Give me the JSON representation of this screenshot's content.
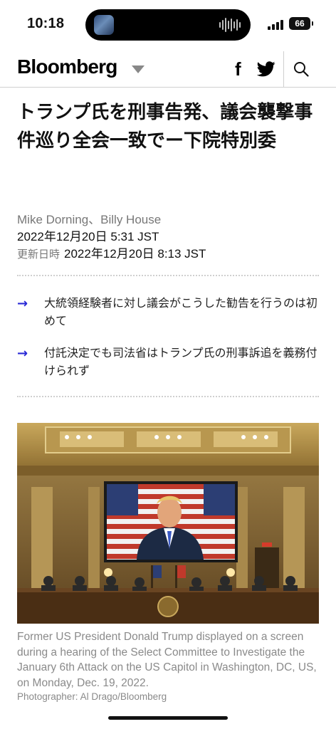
{
  "status_bar": {
    "time": "10:18",
    "battery": "66"
  },
  "nav": {
    "logo": "Bloomberg"
  },
  "article": {
    "headline": "トランプ氏を刑事告発、議会襲撃事件巡り全会一致でー下院特別委",
    "authors": "Mike Dorning、Billy House",
    "published": "2022年12月20日 5:31 JST",
    "updated_label": "更新日時",
    "updated": "2022年12月20日 8:13 JST",
    "bullets": [
      {
        "arrow": "→",
        "text": "大統領経験者に対し議会がこうした勧告を行うのは初めて"
      },
      {
        "arrow": "→",
        "text": "付託決定でも司法省はトランプ氏の刑事訴追を義務付けられず"
      }
    ],
    "caption": "Former US President Donald Trump displayed on a screen during a hearing of the Select Committee to Investigate the January 6th Attack on the US Capitol in Washington, DC, US, on Monday, Dec. 19, 2022.",
    "credit": "Photographer: Al Drago/Bloomberg"
  },
  "icons": {
    "facebook": "facebook-icon",
    "twitter": "twitter-icon",
    "search": "search-icon",
    "menu_caret": "caret-down-icon"
  },
  "colors": {
    "bullet_arrow": "#2a2ad6",
    "muted_text": "#777777",
    "divider": "#cfcfcf"
  }
}
